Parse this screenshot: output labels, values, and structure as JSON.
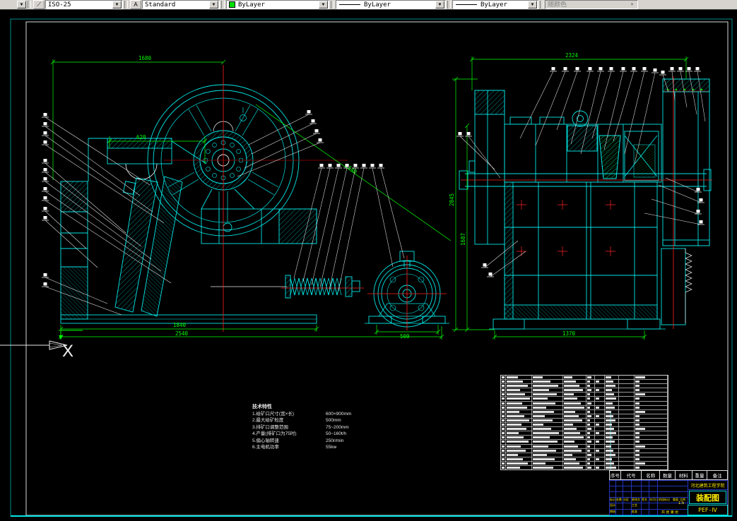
{
  "toolbar": {
    "dim_style": "ISO-25",
    "text_style": "Standard",
    "color_control": "ByLayer",
    "linetype_control": "ByLayer",
    "lineweight_control": "ByLayer",
    "plot_style_control": "随颜色"
  },
  "dims": {
    "overall_width_left": "1680",
    "feed_opening": "620",
    "base_length": "1840",
    "overall_length": "2540",
    "motor_base": "500",
    "belt_span": "2540",
    "overall_width_right": "2324",
    "overall_height": "2845",
    "shaft_height": "1687",
    "base_width_right": "1370"
  },
  "view_marker": {
    "label": "X"
  },
  "notes": {
    "title": "技术特性",
    "items": [
      {
        "label": "1.给矿口尺寸(宽×长)",
        "value": "600×900mm"
      },
      {
        "label": "2.最大给矿粒度",
        "value": "500mm"
      },
      {
        "label": "3.排矿口调整范围",
        "value": "75~200mm"
      },
      {
        "label": "4.产量(排矿口为75时)",
        "value": "50~160t/h"
      },
      {
        "label": "5.偏心轴转速",
        "value": "250r/min"
      },
      {
        "label": "6.主电机功率",
        "value": "55kw"
      }
    ]
  },
  "parts_list": {
    "header": [
      "序号",
      "代号",
      "名称",
      "数量",
      "材料",
      "重量",
      "备注"
    ],
    "visible_rows": 22
  },
  "title_block": {
    "school": "河北建筑工程学院",
    "drawing_name": "装配图",
    "drawing_no": "PEF-Ⅳ",
    "scale": "1:5",
    "stage_header": [
      "阶段标记",
      "重量",
      "比例"
    ],
    "sheet_info": "共 张 第 张",
    "revision_row": [
      "标记",
      "处数",
      "分区",
      "更改文件号",
      "签名",
      "年月日"
    ],
    "role_labels": [
      "设计",
      "审核",
      "工艺",
      "批准"
    ]
  },
  "colors": {
    "geometry_cyan": "#00e5e5",
    "dimension_green": "#00ff00",
    "centerline_red": "#ff2020",
    "title_yellow": "#ffee00",
    "grid_blue": "#2233bb"
  }
}
